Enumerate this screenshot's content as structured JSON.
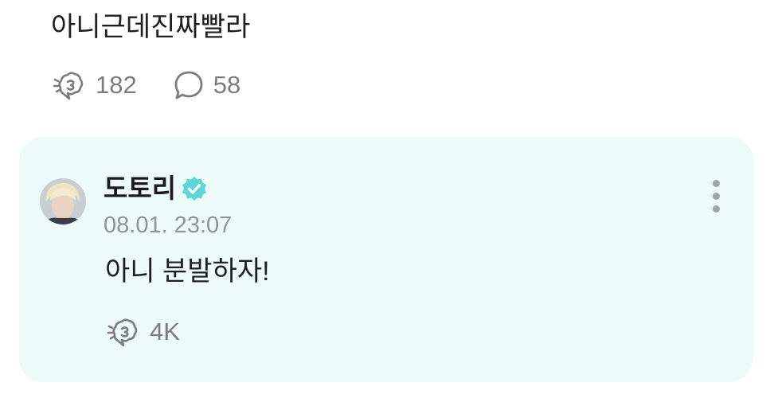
{
  "post": {
    "text": "아니근데진짜빨라",
    "like_count": "182",
    "comment_count": "58",
    "like_icon": "like-cheer-icon",
    "comment_icon": "comment-bubble-icon"
  },
  "reply": {
    "author": "도토리",
    "verified_icon": "verified-badge-icon",
    "timestamp": "08.01. 23:07",
    "text": "아니 분발하자!",
    "like_count": "4K",
    "more_icon": "more-vertical-icon"
  },
  "colors": {
    "card_background": "#ecfaf8",
    "verified_badge": "#5fd6d6",
    "muted_text": "#8e9598"
  }
}
